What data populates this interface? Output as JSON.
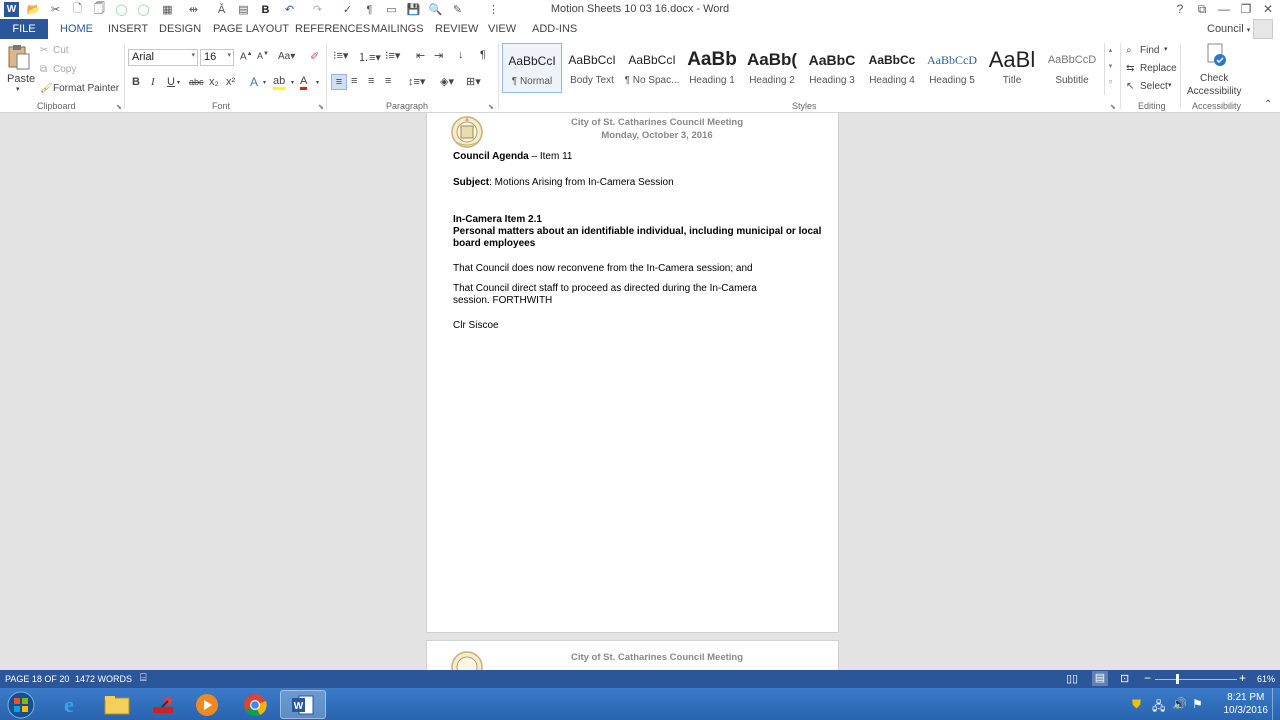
{
  "window": {
    "title": "Motion Sheets 10 03 16.docx - Word",
    "user": "Council",
    "help": "?",
    "ribbon_display": "⧉",
    "minimize": "—",
    "restore": "❐",
    "close": "✕"
  },
  "qat": [
    "W",
    "📂",
    "✂",
    "🗋",
    "🗍",
    "◯",
    "◯",
    "▦",
    "⇹",
    "Ǎ",
    "▤",
    "B",
    "↶",
    "↷",
    "✓",
    "¶",
    "▭",
    "💾",
    "🔍",
    "✎",
    "⋮"
  ],
  "tabs": [
    "FILE",
    "HOME",
    "INSERT",
    "DESIGN",
    "PAGE LAYOUT",
    "REFERENCES",
    "MAILINGS",
    "REVIEW",
    "VIEW",
    "ADD-INS"
  ],
  "clipboard": {
    "paste": "Paste",
    "cut": "Cut",
    "copy": "Copy",
    "format_painter": "Format Painter",
    "group": "Clipboard"
  },
  "font": {
    "name": "Arial",
    "size": "16",
    "group": "Font",
    "buttons": [
      "B",
      "I",
      "U",
      "abc",
      "x₂",
      "x²"
    ]
  },
  "paragraph": {
    "group": "Paragraph"
  },
  "styles": {
    "group": "Styles",
    "items": [
      {
        "preview": "AaBbCcI",
        "name": "¶ Normal"
      },
      {
        "preview": "AaBbCcI",
        "name": "Body Text"
      },
      {
        "preview": "AaBbCcI",
        "name": "¶ No Spac..."
      },
      {
        "preview": "AaBb",
        "name": "Heading 1"
      },
      {
        "preview": "AaBb(",
        "name": "Heading 2"
      },
      {
        "preview": "AaBbC",
        "name": "Heading 3"
      },
      {
        "preview": "AaBbCc",
        "name": "Heading 4"
      },
      {
        "preview": "AaBbCcD",
        "name": "Heading 5"
      },
      {
        "preview": "AaBl",
        "name": "Title"
      },
      {
        "preview": "AaBbCcD",
        "name": "Subtitle"
      }
    ]
  },
  "editing": {
    "group": "Editing",
    "find": "Find",
    "replace": "Replace",
    "select": "Select"
  },
  "accessibility": {
    "group": "Accessibility",
    "check_line1": "Check",
    "check_line2": "Accessibility"
  },
  "document": {
    "header_line1": "City of St. Catharines Council Meeting",
    "header_line2": "Monday, October 3, 2016",
    "agenda_bold": "Council Agenda",
    "agenda_rest": " – Item 11",
    "subject_bold": "Subject",
    "subject_rest": ": Motions Arising from In-Camera Session",
    "item_title": "In-Camera Item 2.1",
    "item_desc": "Personal matters about an identifiable individual, including municipal or local board employees",
    "para1": "That Council does now reconvene from the In-Camera session; and",
    "para2": "That Council direct staff to proceed as directed during the In-Camera session. FORTHWITH",
    "signer": "Clr Siscoe",
    "page2_header": "City of St. Catharines Council Meeting"
  },
  "status": {
    "page": "PAGE 18 OF 20",
    "words": "1472 WORDS",
    "zoom": "61%"
  },
  "clock": {
    "time": "8:21 PM",
    "date": "10/3/2016"
  },
  "colors": {
    "accent": "#2b579a"
  }
}
